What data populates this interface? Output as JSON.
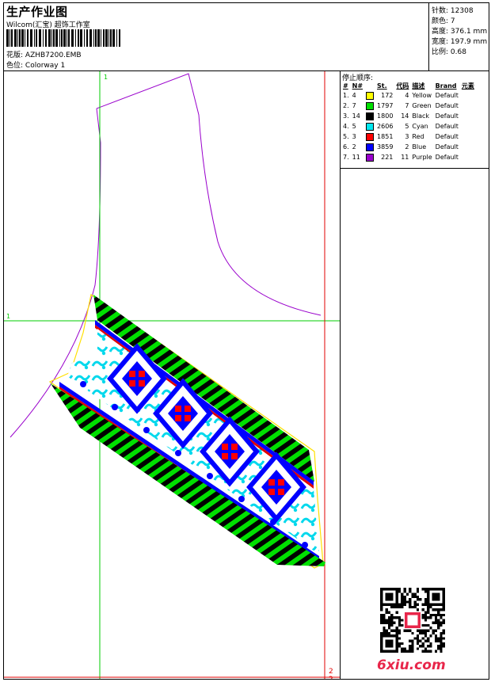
{
  "header": {
    "title": "生产作业图",
    "company": "Wilcom(汇宝) 超饰工作室",
    "design_label": "花版:",
    "design_value": "AZHB7200.EMB",
    "colorway_label": "色位:",
    "colorway_value": "Colorway 1"
  },
  "stats": [
    {
      "label": "针数:",
      "value": "12308"
    },
    {
      "label": "颜色:",
      "value": "7"
    },
    {
      "label": "高度:",
      "value": "376.1 mm"
    },
    {
      "label": "宽度:",
      "value": "197.9 mm"
    },
    {
      "label": "比例:",
      "value": "0.68"
    }
  ],
  "stop_sequence": {
    "title": "停止顺序:",
    "columns": [
      "#",
      "N#",
      "St.",
      "代码",
      "描述",
      "Brand",
      "元素"
    ],
    "rows": [
      {
        "num": "1.",
        "n": "4",
        "color": "#ffff00",
        "st": "172",
        "code": "4",
        "desc": "Yellow",
        "brand": "Default"
      },
      {
        "num": "2.",
        "n": "7",
        "color": "#00e000",
        "st": "1797",
        "code": "7",
        "desc": "Green",
        "brand": "Default"
      },
      {
        "num": "3.",
        "n": "14",
        "color": "#000000",
        "st": "1800",
        "code": "14",
        "desc": "Black",
        "brand": "Default"
      },
      {
        "num": "4.",
        "n": "5",
        "color": "#00e8f0",
        "st": "2606",
        "code": "5",
        "desc": "Cyan",
        "brand": "Default"
      },
      {
        "num": "5.",
        "n": "3",
        "color": "#ff0000",
        "st": "1851",
        "code": "3",
        "desc": "Red",
        "brand": "Default"
      },
      {
        "num": "6.",
        "n": "2",
        "color": "#0000ff",
        "st": "3859",
        "code": "2",
        "desc": "Blue",
        "brand": "Default"
      },
      {
        "num": "7.",
        "n": "11",
        "color": "#9900cc",
        "st": "221",
        "code": "11",
        "desc": "Purple",
        "brand": "Default"
      }
    ]
  },
  "canvas": {
    "guide_label_1": "1",
    "guide_label_2": "1",
    "guide_label_3": "2",
    "guide_label_4": "2"
  },
  "watermark": "6xiu.com",
  "colors": {
    "guide_green": "#00cc00",
    "guide_red": "#e00000",
    "outline_purple": "#9900cc"
  }
}
